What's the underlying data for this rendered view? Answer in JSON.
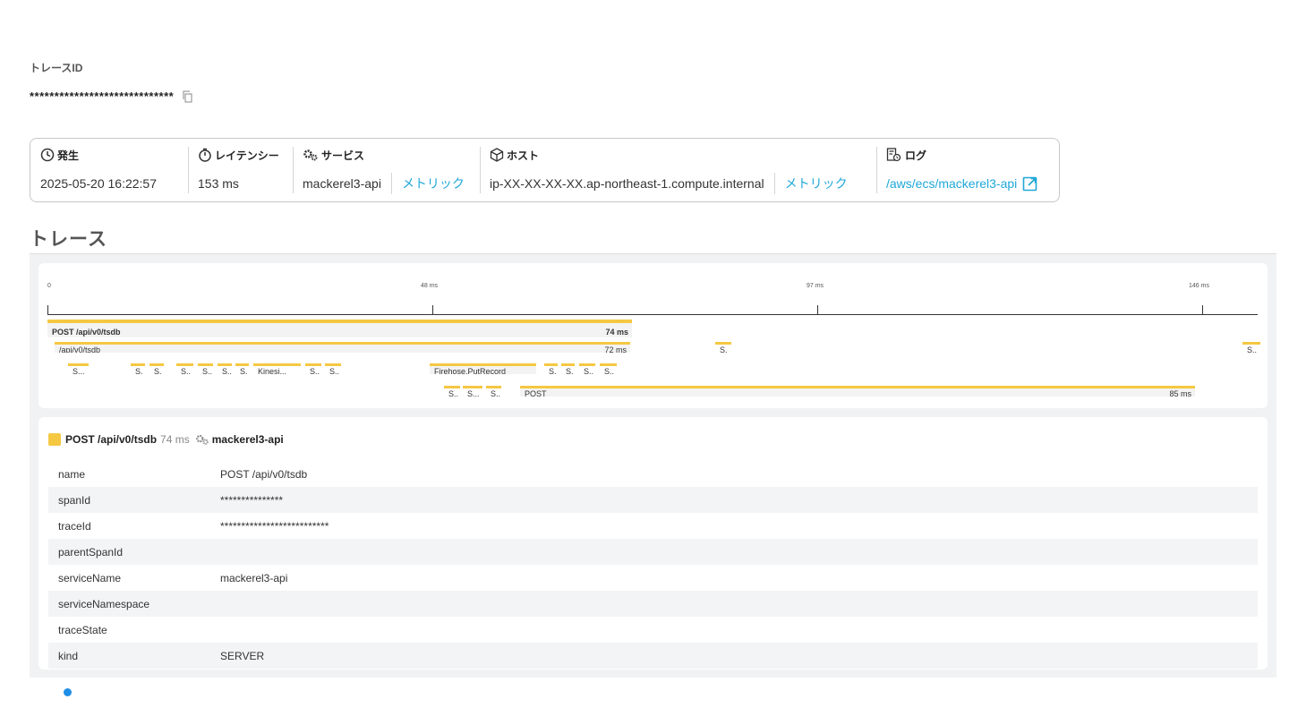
{
  "trace": {
    "id_label": "トレースID",
    "id_value": "*****************************"
  },
  "summary": {
    "occurred": {
      "label": "発生",
      "value": "2025-05-20 16:22:57"
    },
    "latency": {
      "label": "レイテンシー",
      "value": "153 ms"
    },
    "service": {
      "label": "サービス",
      "value": "mackerel3-api",
      "metric_link": "メトリック"
    },
    "host": {
      "label": "ホスト",
      "value": "ip-XX-XX-XX-XX.ap-northeast-1.compute.internal",
      "metric_link": "メトリック"
    },
    "log": {
      "label": "ログ",
      "value": "/aws/ecs/mackerel3-api"
    }
  },
  "section_title": "トレース",
  "timeline": {
    "ticks": [
      "0",
      "48 ms",
      "97 ms",
      "146 ms"
    ],
    "spans": {
      "root": {
        "label": "POST /api/v0/tsdb",
        "duration": "74 ms"
      },
      "child": {
        "label": "/api/v0/tsdb",
        "duration": "72 ms"
      },
      "s_a": "S.",
      "s_b": "S..",
      "s1": "S...",
      "s2": "S.",
      "s3": "S.",
      "s4": "S..",
      "s5": "S..",
      "s6": "S..",
      "s7": "S.",
      "kinesis": "Kinesi...",
      "s8": "S..",
      "s9": "S..",
      "firehose": "Firehose.PutRecord",
      "s10": "S.",
      "s11": "S.",
      "s12": "S..",
      "s13": "S..",
      "s14": "S..",
      "s15": "S...",
      "s16": "S..",
      "post": {
        "label": "POST",
        "duration": "85 ms"
      }
    }
  },
  "detail": {
    "span_name": "POST /api/v0/tsdb",
    "duration": "74 ms",
    "service": "mackerel3-api",
    "attributes": [
      {
        "key": "name",
        "value": "POST /api/v0/tsdb"
      },
      {
        "key": "spanId",
        "value": "***************"
      },
      {
        "key": "traceId",
        "value": "**************************"
      },
      {
        "key": "parentSpanId",
        "value": ""
      },
      {
        "key": "serviceName",
        "value": "mackerel3-api"
      },
      {
        "key": "serviceNamespace",
        "value": ""
      },
      {
        "key": "traceState",
        "value": ""
      },
      {
        "key": "kind",
        "value": "SERVER"
      }
    ]
  },
  "colors": {
    "span": "#f5c842",
    "link": "#1fa7d8",
    "dot": "#1f8ee6"
  }
}
